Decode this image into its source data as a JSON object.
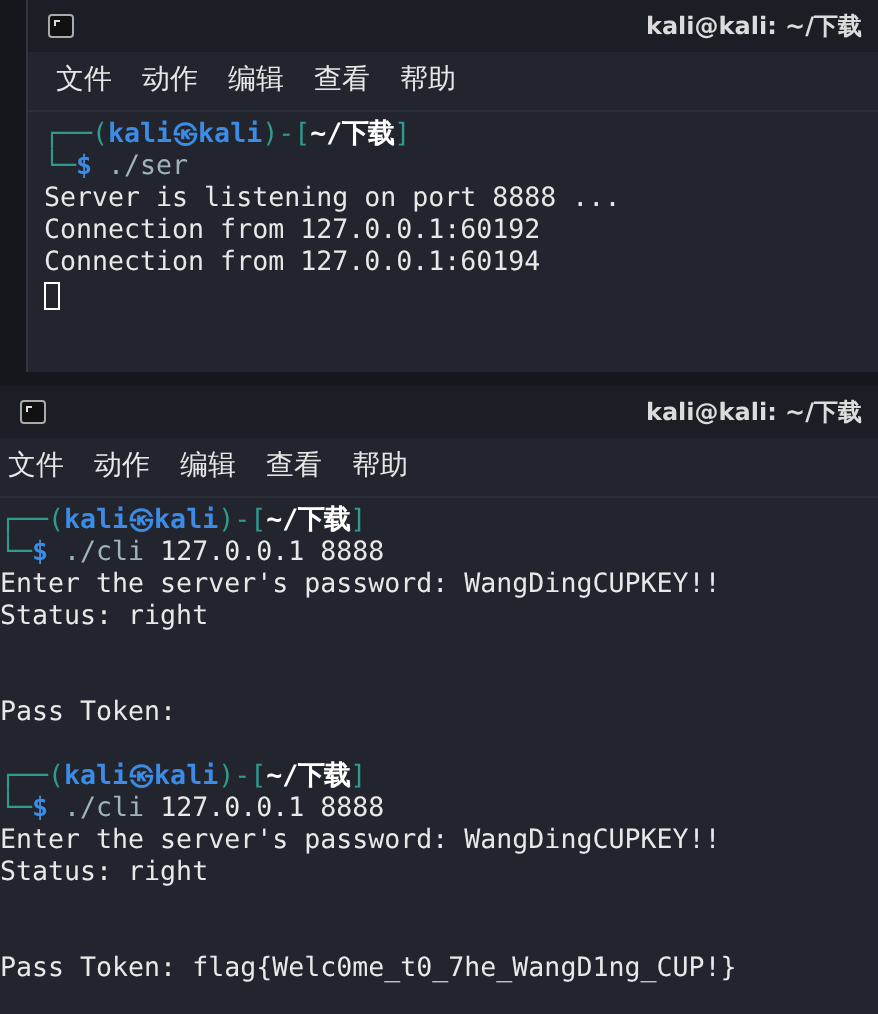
{
  "windows": [
    {
      "title": "kali@kali: ~/下载",
      "menu": [
        "文件",
        "动作",
        "编辑",
        "查看",
        "帮助"
      ],
      "lines": [
        {
          "kind": "prompt",
          "top": [
            {
              "kind": "frame",
              "text": "┌──("
            },
            {
              "kind": "user",
              "text": "kali㉿kali"
            },
            {
              "kind": "frame",
              "text": ")-["
            },
            {
              "kind": "dir",
              "text": "~/下载"
            },
            {
              "kind": "frame",
              "text": "]"
            }
          ],
          "bottom": [
            {
              "kind": "frame",
              "text": "└─"
            },
            {
              "kind": "symbol",
              "text": "$"
            },
            {
              "kind": "command",
              "text": "./ser"
            }
          ]
        },
        {
          "kind": "output",
          "text": "Server is listening on port 8888 ..."
        },
        {
          "kind": "output",
          "text": "Connection from 127.0.0.1:60192"
        },
        {
          "kind": "output",
          "text": "Connection from 127.0.0.1:60194"
        },
        {
          "kind": "cursor"
        }
      ]
    },
    {
      "title": "kali@kali: ~/下载",
      "menu": [
        "文件",
        "动作",
        "编辑",
        "查看",
        "帮助"
      ],
      "lines": [
        {
          "kind": "prompt",
          "top": [
            {
              "kind": "frame",
              "text": "┌──("
            },
            {
              "kind": "user",
              "text": "kali㉿kali"
            },
            {
              "kind": "frame",
              "text": ")-["
            },
            {
              "kind": "dir",
              "text": "~/下载"
            },
            {
              "kind": "frame",
              "text": "]"
            }
          ],
          "bottom": [
            {
              "kind": "frame",
              "text": "└─"
            },
            {
              "kind": "symbol",
              "text": "$"
            },
            {
              "kind": "command",
              "text": "./cli"
            },
            {
              "kind": "args",
              "text": "127.0.0.1 8888"
            }
          ]
        },
        {
          "kind": "output",
          "text": "Enter the server's password: WangDingCUPKEY!!"
        },
        {
          "kind": "output",
          "text": "Status: right"
        },
        {
          "kind": "blank"
        },
        {
          "kind": "blank"
        },
        {
          "kind": "output",
          "text": "Pass Token:"
        },
        {
          "kind": "blank"
        },
        {
          "kind": "prompt",
          "top": [
            {
              "kind": "frame",
              "text": "┌──("
            },
            {
              "kind": "user",
              "text": "kali㉿kali"
            },
            {
              "kind": "frame",
              "text": ")-["
            },
            {
              "kind": "dir",
              "text": "~/下载"
            },
            {
              "kind": "frame",
              "text": "]"
            }
          ],
          "bottom": [
            {
              "kind": "frame",
              "text": "└─"
            },
            {
              "kind": "symbol",
              "text": "$"
            },
            {
              "kind": "command",
              "text": "./cli"
            },
            {
              "kind": "args",
              "text": "127.0.0.1 8888"
            }
          ]
        },
        {
          "kind": "output",
          "text": "Enter the server's password: WangDingCUPKEY!!"
        },
        {
          "kind": "output",
          "text": "Status: right"
        },
        {
          "kind": "blank"
        },
        {
          "kind": "blank"
        },
        {
          "kind": "output",
          "text": "Pass Token: flag{Welc0me_t0_7he_WangD1ng_CUP!}"
        }
      ]
    }
  ]
}
